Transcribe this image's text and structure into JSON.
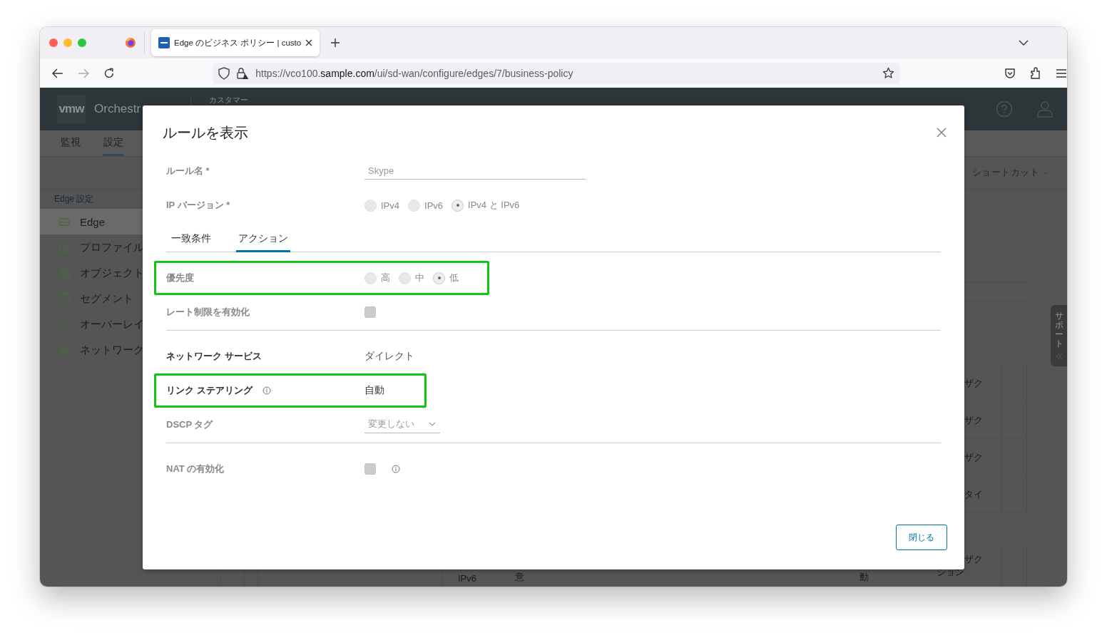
{
  "browser": {
    "tabs": [
      {
        "title": "Edge のビジネス ポリシー | custo",
        "selected": true
      }
    ],
    "url": {
      "prefix": "https://vco100.",
      "domain": "sample.com",
      "path": "/ui/sd-wan/configure/edges/7/business-policy"
    }
  },
  "app": {
    "logo": "vmw",
    "product": "Orchestr",
    "header_label": "カスタマー",
    "nav_tabs": [
      {
        "label": "監視",
        "selected": false
      },
      {
        "label": "設定",
        "selected": true
      }
    ],
    "sidebar": {
      "heading": "Edge 設定",
      "items": [
        {
          "label": "Edge",
          "selected": true
        },
        {
          "label": "プロファイル",
          "selected": false
        },
        {
          "label": "オブジェクト",
          "selected": false
        },
        {
          "label": "セグメント",
          "selected": false
        },
        {
          "label": "オーバーレイ",
          "selected": false
        },
        {
          "label": "ネットワーク",
          "selected": false
        }
      ]
    },
    "shortcut_menu": "ショートカット",
    "support_tab": "サポート",
    "table": {
      "rows": [
        {
          "column_8": "ザク"
        },
        {
          "column_8": "ザク"
        },
        {
          "column_8": "ザク"
        },
        {
          "column_8": "タイ"
        },
        {
          "column_4": "IPv6",
          "column_5": "意",
          "column_7": "動",
          "column_8": "ザク",
          "column_8_line_2": "ション"
        }
      ]
    }
  },
  "dialog": {
    "title": "ルールを表示",
    "fields": [
      {
        "kind": "text_input",
        "label": "ルール名 *",
        "value": "Skype",
        "disabled": true
      },
      {
        "kind": "radio",
        "label": "IP バージョン *",
        "disabled": true,
        "options": [
          {
            "label": "IPv4",
            "selected": false
          },
          {
            "label": "IPv6",
            "selected": false
          },
          {
            "label": "IPv4 と IPv6",
            "selected": true
          }
        ]
      }
    ],
    "tabs": [
      {
        "label": "一致条件",
        "selected": false
      },
      {
        "label": "アクション",
        "selected": true
      }
    ],
    "rows": [
      {
        "kind": "radio",
        "label": "優先度",
        "disabled": true,
        "highlighted": true,
        "options": [
          {
            "label": "高",
            "selected": false
          },
          {
            "label": "中",
            "selected": false
          },
          {
            "label": "低",
            "selected": true
          }
        ]
      },
      {
        "kind": "checkbox",
        "label": "レート制限を有効化",
        "disabled": true,
        "checked": false,
        "divider_after": true
      },
      {
        "kind": "text",
        "label": "ネットワーク サービス",
        "value": "ダイレクト",
        "disabled": false
      },
      {
        "kind": "text",
        "label": "リンク ステアリング",
        "value": "自動",
        "disabled": false,
        "info": true,
        "highlighted": true
      },
      {
        "kind": "select",
        "label": "DSCP タグ",
        "value": "変更しない",
        "disabled": true,
        "divider_after": true
      },
      {
        "kind": "checkbox",
        "label": "NAT の有効化",
        "disabled": true,
        "checked": false,
        "info_after_value": true
      }
    ],
    "close_button": "閉じる"
  }
}
